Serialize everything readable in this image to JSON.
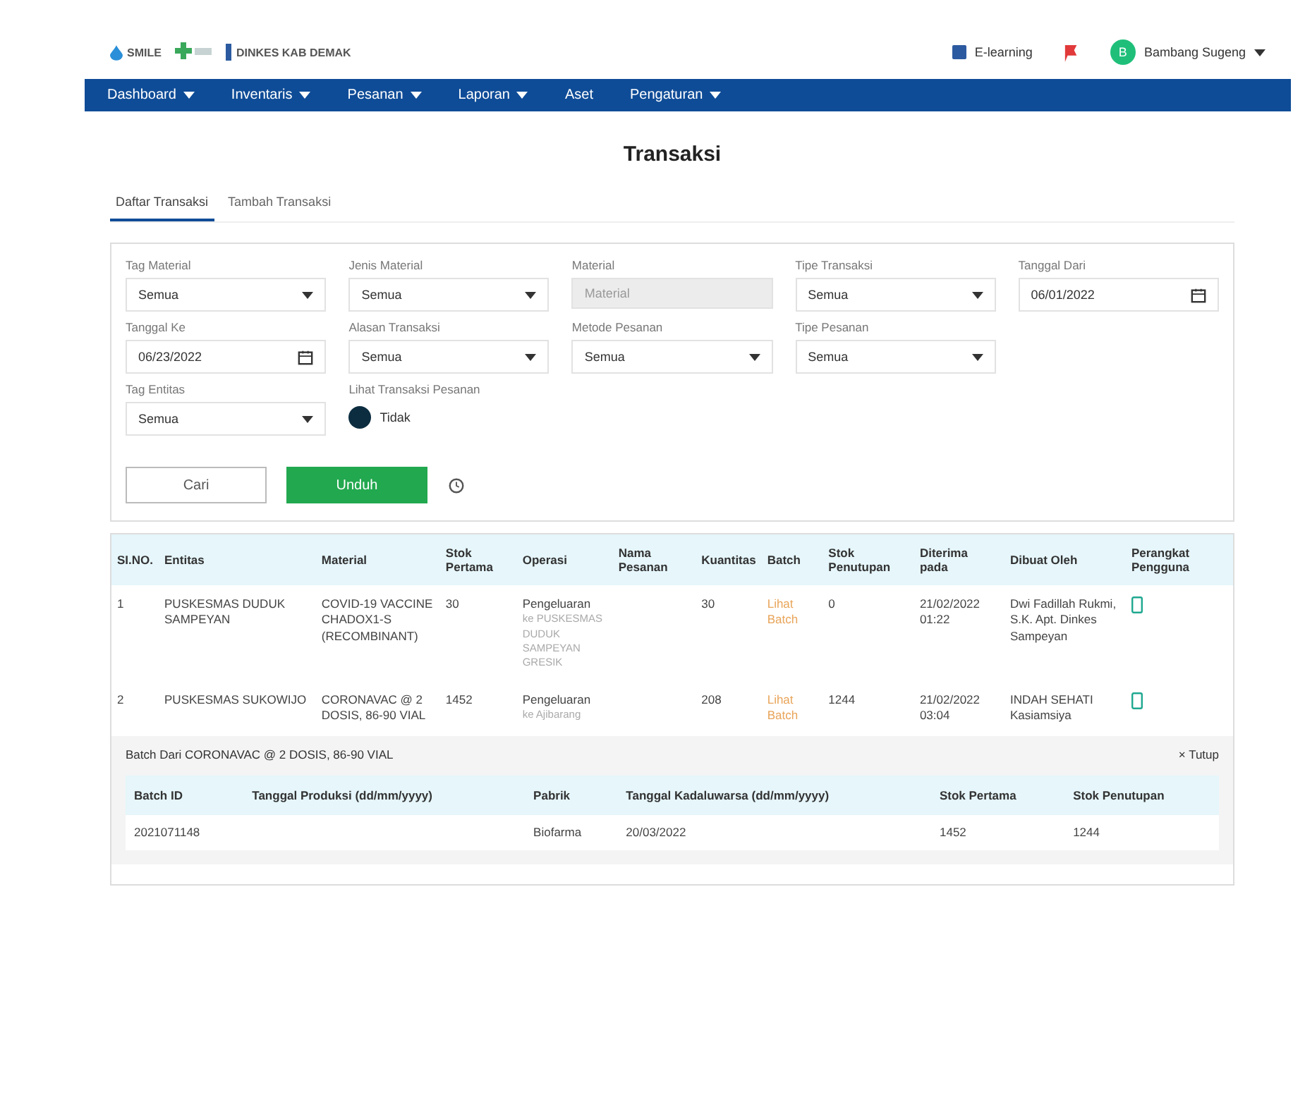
{
  "header": {
    "logos": [
      "SMILE",
      "DINKES KAB DEMAK"
    ],
    "elearning": "E-learning",
    "user": {
      "initial": "B",
      "name": "Bambang Sugeng"
    }
  },
  "nav": [
    {
      "label": "Dashboard",
      "dropdown": true
    },
    {
      "label": "Inventaris",
      "dropdown": true
    },
    {
      "label": "Pesanan",
      "dropdown": true
    },
    {
      "label": "Laporan",
      "dropdown": true
    },
    {
      "label": "Aset",
      "dropdown": false
    },
    {
      "label": "Pengaturan",
      "dropdown": true
    }
  ],
  "title": "Transaksi",
  "tabs": [
    {
      "label": "Daftar Transaksi",
      "selected": true
    },
    {
      "label": "Tambah Transaksi",
      "selected": false
    }
  ],
  "filters": [
    {
      "label": "Tag Material",
      "kind": "select",
      "value": "Semua"
    },
    {
      "label": "Jenis Material",
      "kind": "select",
      "value": "Semua"
    },
    {
      "label": "Material",
      "kind": "text",
      "placeholder": "Material",
      "disabled": true
    },
    {
      "label": "Tipe Transaksi",
      "kind": "select",
      "value": "Semua"
    },
    {
      "label": "Tanggal Dari",
      "kind": "date",
      "value": "06/01/2022"
    },
    {
      "label": "Tanggal Ke",
      "kind": "date",
      "value": "06/23/2022"
    },
    {
      "label": "Alasan Transaksi",
      "kind": "select",
      "value": "Semua"
    },
    {
      "label": "Metode Pesanan",
      "kind": "select",
      "value": "Semua"
    },
    {
      "label": "Tipe Pesanan",
      "kind": "select",
      "value": "Semua"
    },
    {
      "label": "Tag Entitas",
      "kind": "select",
      "value": "Semua"
    },
    {
      "label": "Lihat Transaksi Pesanan",
      "kind": "toggle",
      "on": false,
      "value": "Tidak"
    }
  ],
  "buttons": {
    "search": "Cari",
    "download": "Unduh"
  },
  "table": {
    "columns": [
      "SI.NO.",
      "Entitas",
      "Material",
      "Stok Pertama",
      "Operasi",
      "Nama Pesanan",
      "Kuantitas",
      "Batch",
      "Stok Penutupan",
      "Diterima pada",
      "Dibuat Oleh",
      "Perangkat Pengguna"
    ],
    "rows": [
      {
        "no": "1",
        "entity": "PUSKESMAS DUDUK SAMPEYAN",
        "material": "COVID-19 VACCINE CHADOX1-S (RECOMBINANT)",
        "opening": "30",
        "operation": "Pengeluaran",
        "operation_detail": "ke PUSKESMAS DUDUK SAMPEYAN GRESIK",
        "order": "",
        "quantity": "30",
        "batch": "Lihat Batch",
        "closing": "0",
        "date": "21/02/2022 01:22",
        "by": "Dwi Fadillah Rukmi, S.K. Apt. Dinkes Sampeyan"
      },
      {
        "no": "2",
        "entity": "PUSKESMAS SUKOWIJO",
        "material": "CORONAVAC @ 2 DOSIS, 86-90 VIAL",
        "opening": "1452",
        "operation": "Pengeluaran",
        "operation_detail": "ke Ajibarang",
        "order": "",
        "quantity": "208",
        "batch": "Lihat Batch",
        "closing": "1244",
        "date": "21/02/2022 03:04",
        "by": "INDAH SEHATI Kasiamsiya"
      }
    ]
  },
  "batch_panel": {
    "title": "Batch Dari CORONAVAC @ 2 DOSIS, 86-90 VIAL",
    "close": "× Tutup",
    "columns": [
      "Batch ID",
      "Tanggal Produksi (dd/mm/yyyy)",
      "Pabrik",
      "Tanggal Kadaluwarsa (dd/mm/yyyy)",
      "Stok Pertama",
      "Stok Penutupan"
    ],
    "rows": [
      [
        "2021071148",
        "",
        "Biofarma",
        "20/03/2022",
        "1452",
        "1244"
      ]
    ]
  }
}
